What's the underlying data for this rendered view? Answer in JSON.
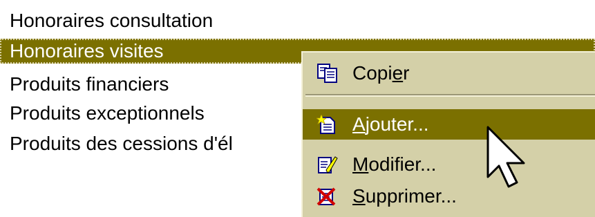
{
  "list": {
    "items": [
      {
        "label": "Honoraires consultation"
      },
      {
        "label": "Honoraires visites"
      },
      {
        "label": "Produits financiers"
      },
      {
        "label": "Produits exceptionnels"
      },
      {
        "label": "Produits des cessions d'él"
      }
    ],
    "selected_index": 1
  },
  "context_menu": {
    "items": [
      {
        "pre": "Copi",
        "accel": "e",
        "post": "r",
        "icon": "copy-icon"
      },
      {
        "pre": "",
        "accel": "A",
        "post": "jouter...",
        "icon": "new-document-icon"
      },
      {
        "pre": "",
        "accel": "M",
        "post": "odifier...",
        "icon": "edit-document-icon"
      },
      {
        "pre": "",
        "accel": "S",
        "post": "upprimer...",
        "icon": "delete-icon"
      }
    ],
    "highlighted_index": 1
  },
  "colors": {
    "selection": "#7b7000",
    "menu_background": "#d4d0a8"
  }
}
